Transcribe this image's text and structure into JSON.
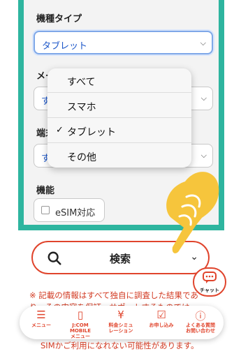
{
  "form": {
    "device_type_label": "機種タイプ",
    "device_type_value": "タブレット",
    "maker_label": "メー",
    "maker_value": "す",
    "terminal_label": "端末",
    "terminal_value": "す",
    "feature_label": "機能",
    "esim_label": "eSIM対応"
  },
  "dropdown": {
    "options": [
      {
        "label": "すべて",
        "checked": false
      },
      {
        "label": "スマホ",
        "checked": false
      },
      {
        "label": "タブレット",
        "checked": true
      },
      {
        "label": "その他",
        "checked": false
      }
    ],
    "check_mark": "✓"
  },
  "search": {
    "label": "検索"
  },
  "chat": {
    "label": "チャット"
  },
  "notice": {
    "text": "※ 記載の情報はすべて独自に調査した結果であり、その内容を保証・サポートするものでは",
    "bottom_text": "SIMかご利用になれない可能性があります。"
  },
  "footer": {
    "items": [
      {
        "icon": "menu-icon",
        "label1": "メニュー",
        "label2": ""
      },
      {
        "icon": "phone-icon",
        "label1": "J:COM MOBILE",
        "label2": "メニュー"
      },
      {
        "icon": "yen-icon",
        "label1": "料金シミュ",
        "label2": "レーション"
      },
      {
        "icon": "apply-icon",
        "label1": "お申し込み",
        "label2": ""
      },
      {
        "icon": "help-icon",
        "label1": "よくある質問",
        "label2": "お問い合わせ"
      }
    ]
  },
  "colors": {
    "accent": "#2eb59f",
    "brand_red": "#e0442c",
    "hand": "#f6c53c"
  }
}
